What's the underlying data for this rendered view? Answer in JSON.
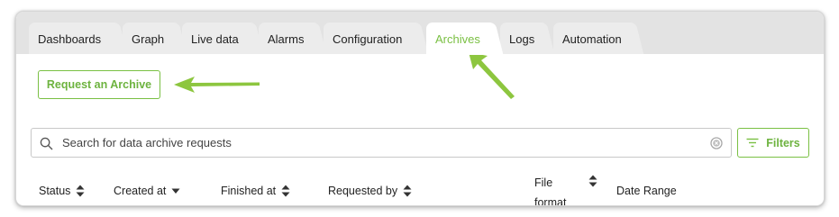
{
  "tabs": [
    {
      "label": "Dashboards",
      "active": false
    },
    {
      "label": "Graph",
      "active": false
    },
    {
      "label": "Live data",
      "active": false
    },
    {
      "label": "Alarms",
      "active": false
    },
    {
      "label": "Configuration",
      "active": false
    },
    {
      "label": "Archives",
      "active": true
    },
    {
      "label": "Logs",
      "active": false
    },
    {
      "label": "Automation",
      "active": false
    }
  ],
  "actions": {
    "request_label": "Request an Archive",
    "filters_label": "Filters"
  },
  "search": {
    "placeholder": "Search for data archive requests",
    "value": ""
  },
  "table": {
    "columns": [
      {
        "label": "Status",
        "sort_icon": "sort-both-icon"
      },
      {
        "label": "Created at",
        "sort_icon": "sort-desc-icon"
      },
      {
        "label": "Finished at",
        "sort_icon": "sort-both-icon"
      },
      {
        "label": "Requested by",
        "sort_icon": "sort-both-icon"
      },
      {
        "label": "File format",
        "sort_icon": "sort-both-icon"
      },
      {
        "label": "Date Range",
        "sort_icon": ""
      }
    ]
  },
  "colors": {
    "accent": "#7ac043",
    "annotation_arrow": "#8dc63f",
    "tab_bar": "#e3e3e3"
  }
}
